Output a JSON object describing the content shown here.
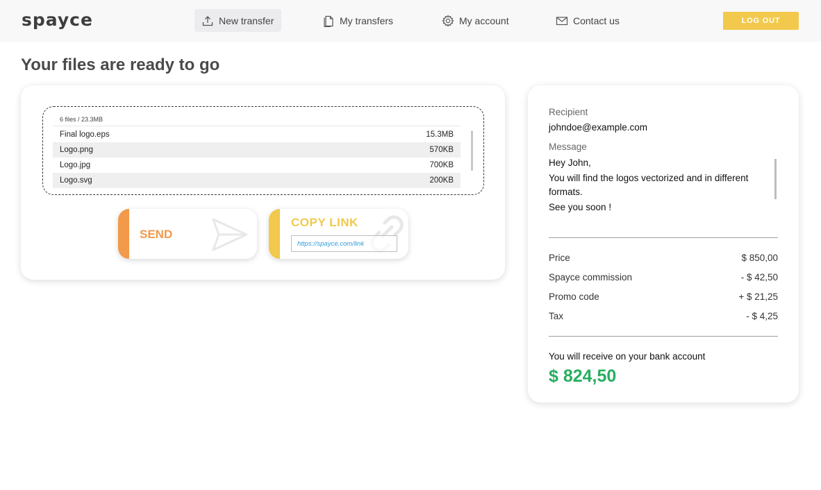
{
  "header": {
    "logo": "spayce",
    "nav": [
      {
        "label": "New transfer",
        "icon": "upload-icon",
        "active": true
      },
      {
        "label": "My transfers",
        "icon": "files-icon",
        "active": false
      },
      {
        "label": "My account",
        "icon": "gear-icon",
        "active": false
      },
      {
        "label": "Contact us",
        "icon": "mail-icon",
        "active": false
      }
    ],
    "logout_label": "LOG OUT"
  },
  "page": {
    "title": "Your files are ready to go"
  },
  "files": {
    "summary": "6 files / 23.3MB",
    "items": [
      {
        "name": "Final logo.eps",
        "size": "15.3MB"
      },
      {
        "name": "Logo.png",
        "size": "570KB"
      },
      {
        "name": "Logo.jpg",
        "size": "700KB"
      },
      {
        "name": "Logo.svg",
        "size": "200KB"
      }
    ]
  },
  "actions": {
    "send_label": "SEND",
    "copy_label": "COPY LINK",
    "link_value": "https://spayce.com/link"
  },
  "details": {
    "recipient_label": "Recipient",
    "recipient_value": "johndoe@example.com",
    "message_label": "Message",
    "message_lines": [
      "Hey John,",
      "You will find the logos vectorized and in different formats.",
      "See you soon !"
    ],
    "fees": [
      {
        "label": "Price",
        "value": "$ 850,00"
      },
      {
        "label": "Spayce commission",
        "value": "- $ 42,50"
      },
      {
        "label": "Promo code",
        "value": "+ $ 21,25"
      },
      {
        "label": "Tax",
        "value": "- $ 4,25"
      }
    ],
    "receive_label": "You will receive on your bank account",
    "total": "$ 824,50"
  },
  "colors": {
    "accent_yellow": "#f2c94c",
    "accent_orange": "#f2994a",
    "total_green": "#27ae60",
    "link_blue": "#2d9cdb"
  }
}
